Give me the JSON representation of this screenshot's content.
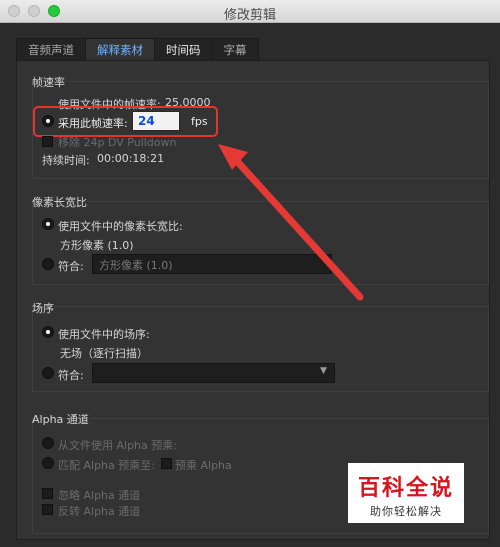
{
  "window": {
    "title": "修改剪辑"
  },
  "tabs": [
    {
      "label": "音频声道"
    },
    {
      "label": "解释素材"
    },
    {
      "label": "时间码"
    },
    {
      "label": "字幕"
    }
  ],
  "frame_rate": {
    "heading": "帧速率",
    "use_file_rate": "使用文件中的帧速率:",
    "file_rate_value": "25.0000",
    "assume_rate": "采用此帧速率:",
    "assume_rate_value": "24",
    "fps_unit": "fps",
    "remove_pulldown": "移除 24p DV Pulldown",
    "duration_label": "持续时间:",
    "duration_value": "00:00:18:21"
  },
  "pixel_aspect": {
    "heading": "像素长宽比",
    "use_file_option": "使用文件中的像素长宽比:",
    "file_value": "方形像素 (1.0)",
    "conform_label": "符合:",
    "conform_value": "方形像素 (1.0)"
  },
  "field_order": {
    "heading": "场序",
    "use_file_option": "使用文件中的场序:",
    "file_value": "无场（逐行扫描）",
    "conform_label": "符合:",
    "conform_value": ""
  },
  "alpha": {
    "heading": "Alpha 通道",
    "from_file": "从文件使用 Alpha 预乘:",
    "premultiply": "匹配 Alpha 预乘至:",
    "premultiply_alpha": "预乘 Alpha",
    "ignore": "忽略 Alpha 通道",
    "invert": "反转 Alpha 通道"
  },
  "watermark": {
    "line1": "百科全说",
    "line2": "助你轻松解决"
  },
  "colors": {
    "accent_tab": "#6fb0ff",
    "highlight": "#e3342f",
    "arrow": "#e53935"
  }
}
